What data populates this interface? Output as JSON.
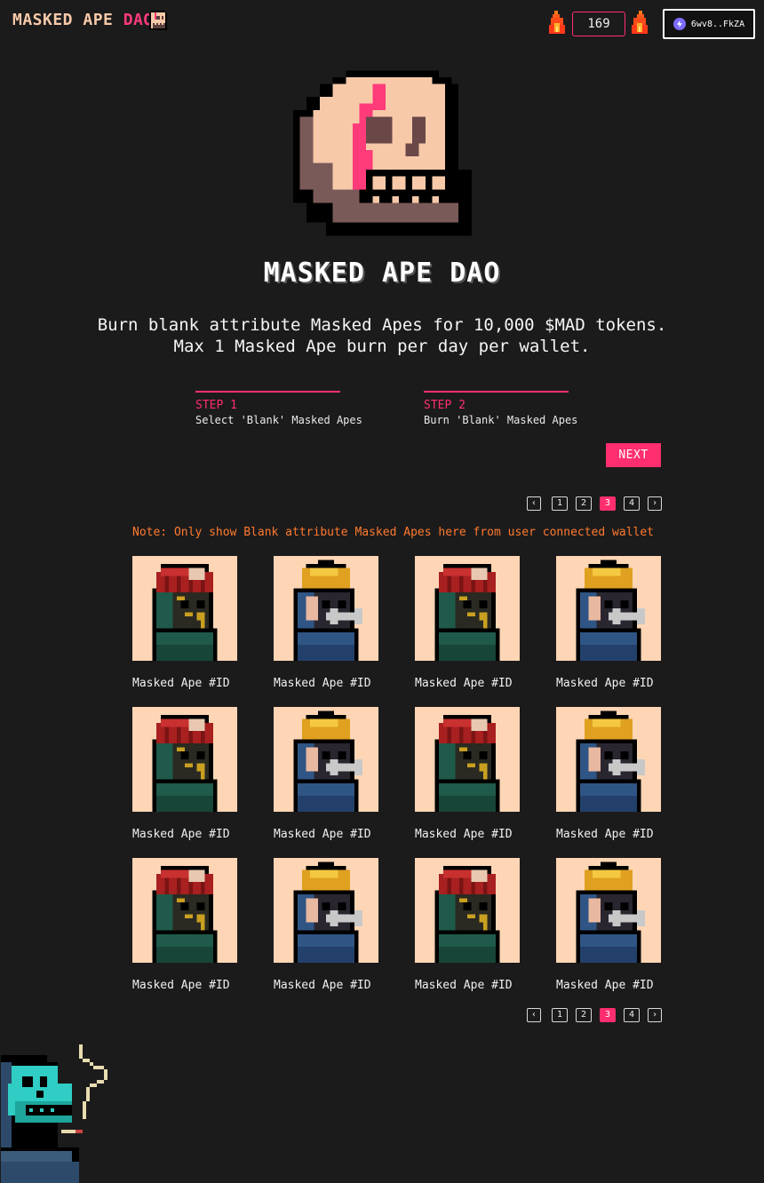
{
  "header": {
    "logo_main": "MASKED APE ",
    "logo_dao": "DAO",
    "counter_value": "169",
    "wallet_address": "6wv8..FkZA"
  },
  "hero": {
    "title": "MASKED APE DAO",
    "subtitle_line1": "Burn blank attribute Masked Apes for 10,000 $MAD tokens.",
    "subtitle_line2": "Max 1 Masked Ape burn per day per wallet."
  },
  "steps": [
    {
      "num": "STEP 1",
      "desc": "Select 'Blank' Masked Apes"
    },
    {
      "num": "STEP 2",
      "desc": "Burn 'Blank' Masked Apes"
    }
  ],
  "next_label": "NEXT",
  "pagination": {
    "prev": "‹",
    "next": "›",
    "pages": [
      "1",
      "2",
      "3",
      "4"
    ],
    "active_page": "3"
  },
  "note": "Note: Only show Blank attribute Masked Apes here from user connected wallet",
  "cards": [
    {
      "label": "Masked Ape #ID",
      "variant": "red-beanie"
    },
    {
      "label": "Masked Ape #ID",
      "variant": "yellow-helmet"
    },
    {
      "label": "Masked Ape #ID",
      "variant": "red-beanie"
    },
    {
      "label": "Masked Ape #ID",
      "variant": "yellow-helmet"
    },
    {
      "label": "Masked Ape #ID",
      "variant": "red-beanie"
    },
    {
      "label": "Masked Ape #ID",
      "variant": "yellow-helmet"
    },
    {
      "label": "Masked Ape #ID",
      "variant": "red-beanie"
    },
    {
      "label": "Masked Ape #ID",
      "variant": "yellow-helmet"
    },
    {
      "label": "Masked Ape #ID",
      "variant": "red-beanie"
    },
    {
      "label": "Masked Ape #ID",
      "variant": "yellow-helmet"
    },
    {
      "label": "Masked Ape #ID",
      "variant": "red-beanie"
    },
    {
      "label": "Masked Ape #ID",
      "variant": "yellow-helmet"
    }
  ],
  "colors": {
    "accent": "#ff2e6e",
    "note": "#ff7a2e",
    "background": "#1c1b1c",
    "card_bg": "#ffd6b5"
  }
}
